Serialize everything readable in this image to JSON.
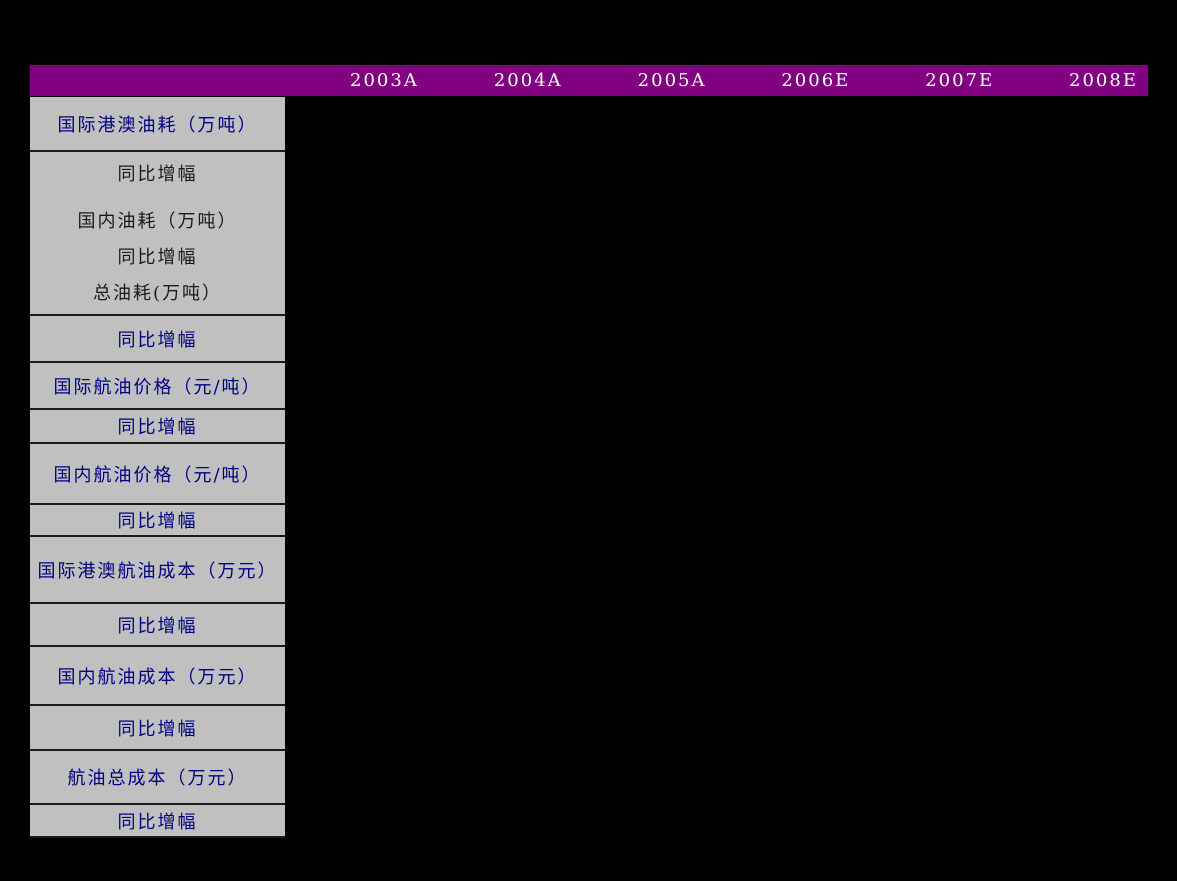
{
  "colors": {
    "page_background": "#000000",
    "header_background": "#800080",
    "header_text": "#ffffff",
    "row_header_background": "#c0c0c0",
    "row_header_primary_text": "#000080",
    "row_header_secondary_text": "#1a1a1a",
    "cell_border": "#1a1a1a"
  },
  "table": {
    "header": {
      "columns": [
        "2003A",
        "2004A",
        "2005A",
        "2006E",
        "2007E",
        "2008E"
      ]
    },
    "row_header_column": {
      "rows": [
        {
          "label": "国际港澳油耗（万吨）",
          "style": "primary"
        },
        {
          "lines": [
            "同比增幅",
            "国内油耗（万吨）",
            "同比增幅",
            "总油耗(万吨）"
          ],
          "style": "secondary"
        },
        {
          "label": "同比增幅",
          "style": "primary"
        },
        {
          "label": "国际航油价格（元/吨）",
          "style": "primary"
        },
        {
          "label": "同比增幅",
          "style": "primary"
        },
        {
          "label": "国内航油价格（元/吨）",
          "style": "primary"
        },
        {
          "label": "同比增幅",
          "style": "primary"
        },
        {
          "label": "国际港澳航油成本（万元）",
          "style": "primary"
        },
        {
          "label": "同比增幅",
          "style": "primary"
        },
        {
          "label": "国内航油成本（万元）",
          "style": "primary"
        },
        {
          "label": "同比增幅",
          "style": "primary"
        },
        {
          "label": "航油总成本（万元）",
          "style": "primary"
        },
        {
          "label": "同比增幅",
          "style": "primary"
        }
      ]
    },
    "body": {
      "cells_visible": false
    }
  }
}
